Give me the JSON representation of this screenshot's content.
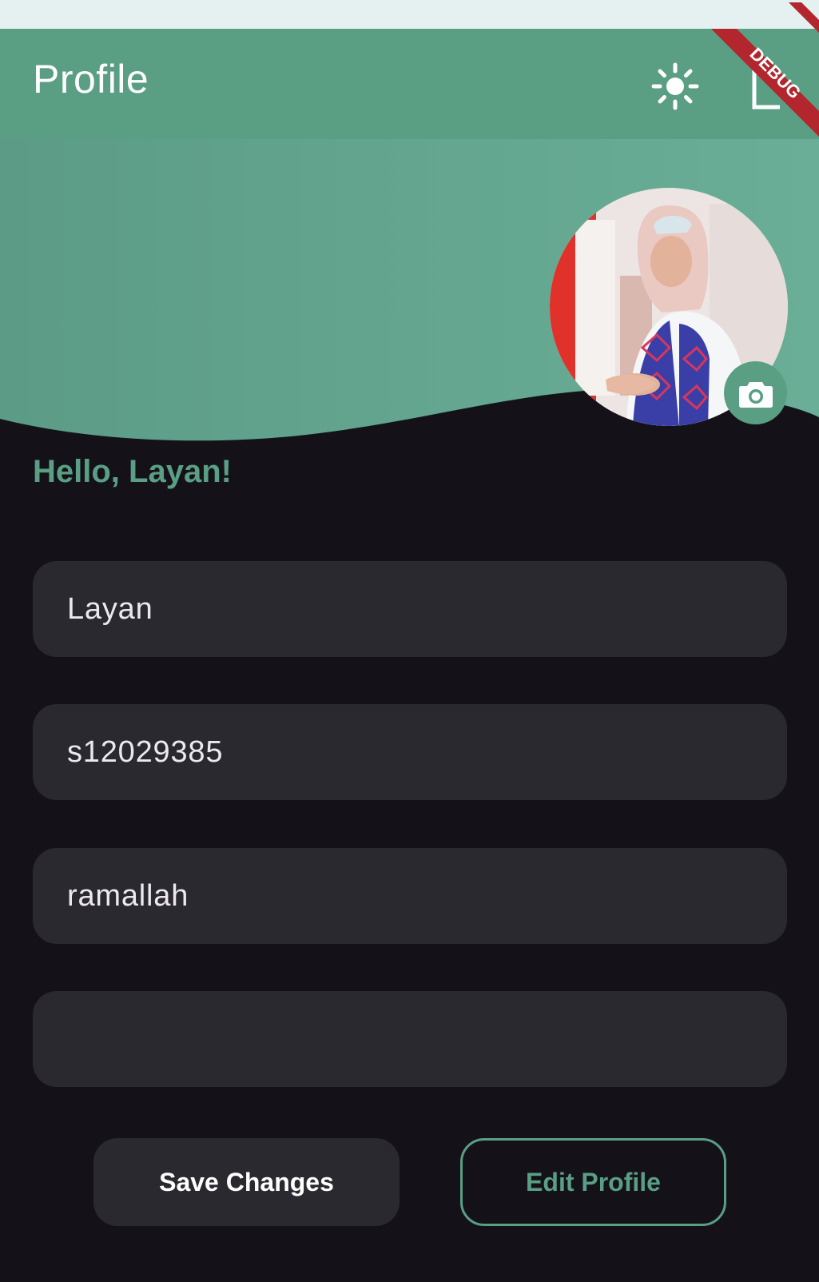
{
  "app_bar": {
    "title": "Profile",
    "theme_icon": "sun-icon",
    "logout_icon": "logout-icon"
  },
  "debug_banner": "DEBUG",
  "profile": {
    "greeting": "Hello, Layan!",
    "avatar_icon": "avatar-photo",
    "camera_icon": "camera-icon"
  },
  "form": {
    "name_value": "Layan",
    "id_value": "s12029385",
    "city_value": "ramallah",
    "fourth_value": ""
  },
  "buttons": {
    "save_label": "Save Changes",
    "edit_label": "Edit Profile"
  },
  "colors": {
    "primary": "#5a9e84",
    "background": "#141218",
    "field": "#2b2930",
    "debug": "#b3262e"
  }
}
